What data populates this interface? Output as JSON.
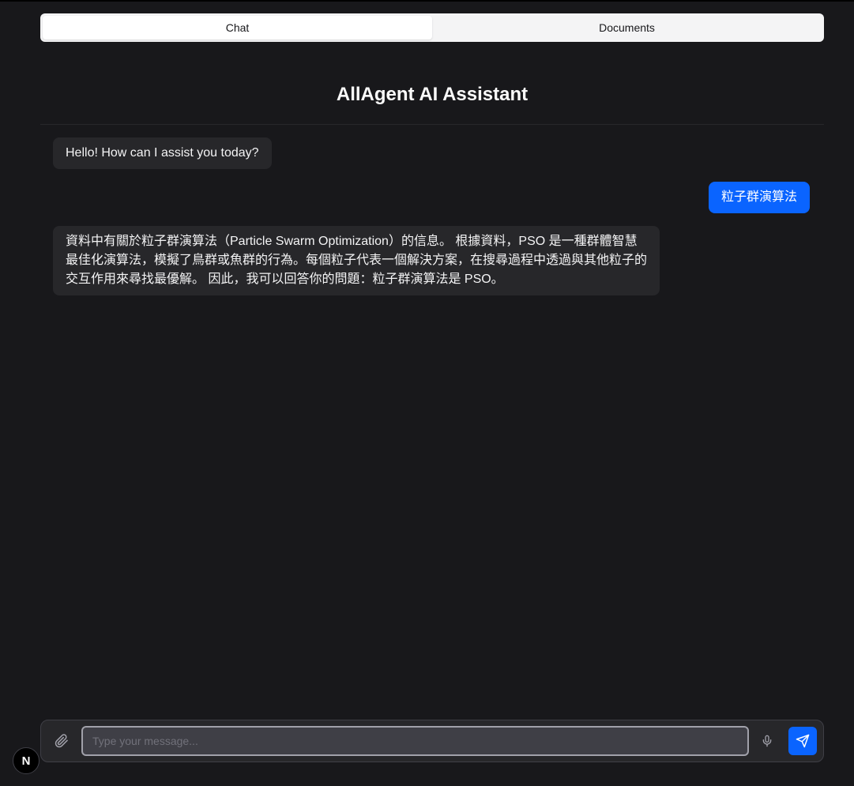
{
  "tabs": [
    {
      "label": "Chat",
      "active": true
    },
    {
      "label": "Documents",
      "active": false
    }
  ],
  "header": {
    "title": "AllAgent AI Assistant"
  },
  "messages": [
    {
      "role": "assistant",
      "text": "Hello! How can I assist you today?"
    },
    {
      "role": "user",
      "text": "粒子群演算法"
    },
    {
      "role": "assistant",
      "text": "資料中有關於粒子群演算法（Particle Swarm Optimization）的信息。 根據資料，PSO 是一種群體智慧最佳化演算法，模擬了鳥群或魚群的行為。每個粒子代表一個解決方案，在搜尋過程中透過與其他粒子的交互作用來尋找最優解。 因此，我可以回答你的問題：粒子群演算法是 PSO。"
    }
  ],
  "composer": {
    "value": "",
    "placeholder": "Type your message...",
    "attach_icon": "paperclip-icon",
    "mic_icon": "microphone-icon",
    "send_icon": "send-icon"
  },
  "badge": {
    "label": "N"
  },
  "colors": {
    "background": "#18181b",
    "assistant_bubble": "#27272a",
    "user_bubble": "#0a64ff",
    "accent": "#0a64ff"
  }
}
